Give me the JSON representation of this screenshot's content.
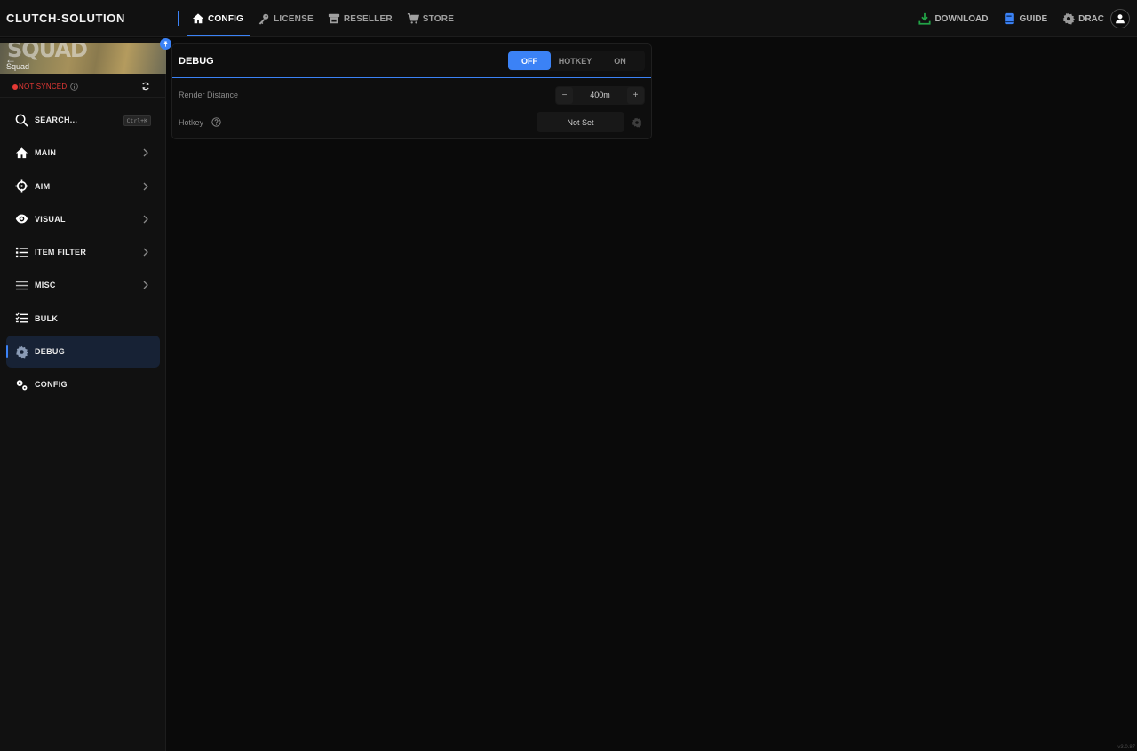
{
  "header": {
    "brand": "CLUTCH-SOLUTION",
    "nav": [
      {
        "label": "CONFIG",
        "icon": "home-icon",
        "active": true
      },
      {
        "label": "LICENSE",
        "icon": "key-icon",
        "active": false
      },
      {
        "label": "RESELLER",
        "icon": "storefront-icon",
        "active": false
      },
      {
        "label": "STORE",
        "icon": "cart-icon",
        "active": false
      }
    ],
    "right": {
      "download": "DOWNLOAD",
      "guide": "GUIDE",
      "user": "DRAC"
    }
  },
  "sidebar": {
    "game": {
      "title": "SQUAD",
      "name": "Squad",
      "back": "←"
    },
    "sync_status": "NOT SYNCED",
    "search": {
      "label": "SEARCH...",
      "shortcut": "Ctrl+K"
    },
    "items": [
      {
        "label": "MAIN",
        "icon": "home-icon",
        "has_chevron": true
      },
      {
        "label": "AIM",
        "icon": "crosshair-icon",
        "has_chevron": true
      },
      {
        "label": "VISUAL",
        "icon": "eye-icon",
        "has_chevron": true
      },
      {
        "label": "ITEM FILTER",
        "icon": "list-icon",
        "has_chevron": true
      },
      {
        "label": "MISC",
        "icon": "menu-icon",
        "has_chevron": true
      },
      {
        "label": "BULK",
        "icon": "checklist-icon",
        "has_chevron": false
      },
      {
        "label": "DEBUG",
        "icon": "gear-icon",
        "has_chevron": false,
        "active": true
      },
      {
        "label": "CONFIG",
        "icon": "gears-icon",
        "has_chevron": false
      }
    ]
  },
  "panel": {
    "title": "DEBUG",
    "mode": {
      "options": [
        "OFF",
        "HOTKEY",
        "ON"
      ],
      "selected": "OFF"
    },
    "render_distance": {
      "label": "Render Distance",
      "value": "400m",
      "minus": "−",
      "plus": "+"
    },
    "hotkey": {
      "label": "Hotkey",
      "value": "Not Set"
    }
  },
  "version": "v3.0.87",
  "colors": {
    "accent": "#3b82f6",
    "danger": "#e53935",
    "download": "#22a447",
    "guide": "#3b82f6"
  }
}
